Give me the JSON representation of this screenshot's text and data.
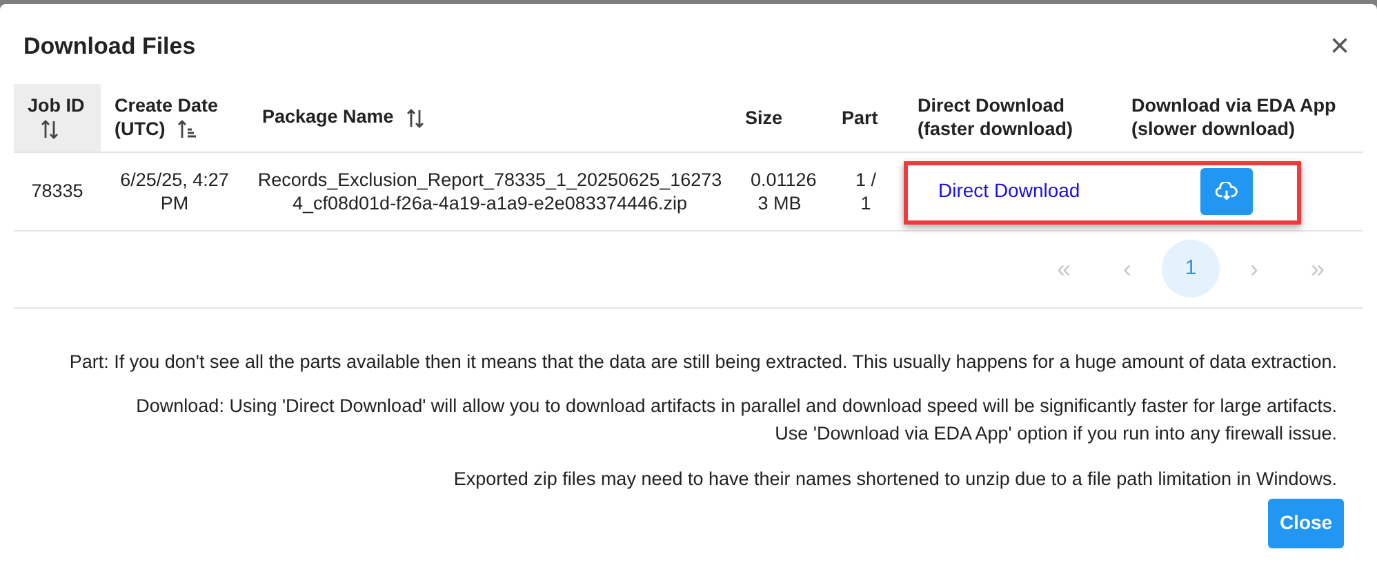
{
  "dialog": {
    "title": "Download Files",
    "close_label": "×"
  },
  "table": {
    "columns": [
      {
        "label": "Job ID",
        "sortable": true,
        "sorted": false,
        "highlighted": true
      },
      {
        "label": "Create Date (UTC)",
        "sortable": true,
        "sorted": true,
        "highlighted": false
      },
      {
        "label": "Package Name",
        "sortable": true,
        "sorted": false,
        "highlighted": false
      },
      {
        "label": "Size",
        "sortable": false,
        "highlighted": false
      },
      {
        "label": "Part",
        "sortable": false,
        "highlighted": false
      },
      {
        "label": "Direct Download (faster download)",
        "sortable": false,
        "highlighted": false
      },
      {
        "label": "Download via EDA App (slower download)",
        "sortable": false,
        "highlighted": false
      }
    ],
    "rows": [
      {
        "job_id": "78335",
        "create_date": "6/25/25, 4:27 PM",
        "package_name": "Records_Exclusion_Report_78335_1_20250625_162734_cf08d01d-f26a-4a19-a1a9-e2e083374446.zip",
        "size": "0.01126 3 MB",
        "part": "1 / 1",
        "direct_link": "Direct Download",
        "outlined": true
      }
    ]
  },
  "pagination": {
    "first": {
      "label": "«",
      "disabled": true
    },
    "prev": {
      "label": "‹",
      "disabled": true
    },
    "pages": [
      {
        "label": "1",
        "selected": true
      }
    ],
    "next": {
      "label": "›",
      "disabled": true
    },
    "last": {
      "label": "»",
      "disabled": true
    }
  },
  "notes": [
    "Part: If you don't see all the parts available then it means that the data are still being extracted. This usually happens for a huge amount of data extraction.",
    "Download: Using 'Direct Download' will allow you to download artifacts in parallel and download speed will be significantly faster for large artifacts.",
    "Use 'Download via EDA App' option if you run into any firewall issue.",
    "Exported zip files may need to have their names shortened to unzip due to a file path limitation in Windows."
  ],
  "close_button": "Close"
}
